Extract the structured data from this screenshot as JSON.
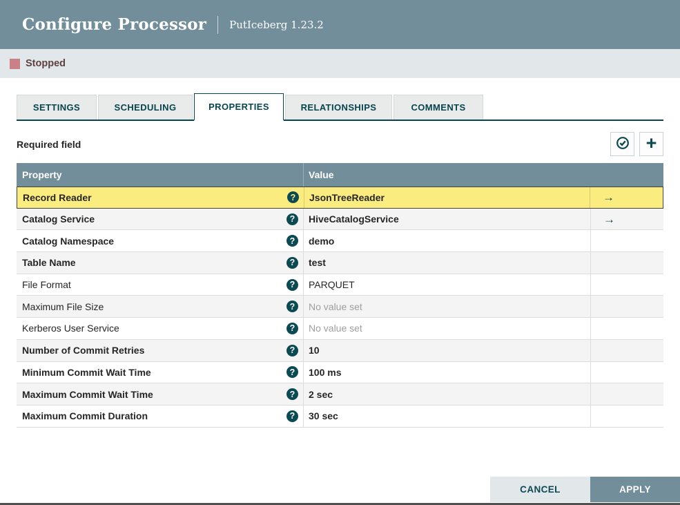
{
  "dialog": {
    "title": "Configure Processor",
    "subtitle": "PutIceberg 1.23.2"
  },
  "status": {
    "label": "Stopped",
    "color": "#CA8087"
  },
  "tabs": [
    {
      "label": "SETTINGS",
      "active": false
    },
    {
      "label": "SCHEDULING",
      "active": false
    },
    {
      "label": "PROPERTIES",
      "active": true
    },
    {
      "label": "RELATIONSHIPS",
      "active": false
    },
    {
      "label": "COMMENTS",
      "active": false
    }
  ],
  "properties_panel": {
    "required_field_label": "Required field",
    "table": {
      "columns": [
        "Property",
        "Value"
      ],
      "rows": [
        {
          "property": "Record Reader",
          "value": "JsonTreeReader",
          "required": true,
          "selected": true,
          "empty": false,
          "has_link": true
        },
        {
          "property": "Catalog Service",
          "value": "HiveCatalogService",
          "required": true,
          "selected": false,
          "empty": false,
          "has_link": true
        },
        {
          "property": "Catalog Namespace",
          "value": "demo",
          "required": true,
          "selected": false,
          "empty": false,
          "has_link": false
        },
        {
          "property": "Table Name",
          "value": "test",
          "required": true,
          "selected": false,
          "empty": false,
          "has_link": false
        },
        {
          "property": "File Format",
          "value": "PARQUET",
          "required": false,
          "selected": false,
          "empty": false,
          "has_link": false
        },
        {
          "property": "Maximum File Size",
          "value": "No value set",
          "required": false,
          "selected": false,
          "empty": true,
          "has_link": false
        },
        {
          "property": "Kerberos User Service",
          "value": "No value set",
          "required": false,
          "selected": false,
          "empty": true,
          "has_link": false
        },
        {
          "property": "Number of Commit Retries",
          "value": "10",
          "required": true,
          "selected": false,
          "empty": false,
          "has_link": false
        },
        {
          "property": "Minimum Commit Wait Time",
          "value": "100 ms",
          "required": true,
          "selected": false,
          "empty": false,
          "has_link": false
        },
        {
          "property": "Maximum Commit Wait Time",
          "value": "2 sec",
          "required": true,
          "selected": false,
          "empty": false,
          "has_link": false
        },
        {
          "property": "Maximum Commit Duration",
          "value": "30 sec",
          "required": true,
          "selected": false,
          "empty": false,
          "has_link": false
        }
      ]
    }
  },
  "icons": {
    "help_glyph": "?",
    "plus_glyph": "+",
    "arrow_glyph": "→",
    "verify": "check-circle"
  },
  "footer": {
    "cancel_label": "CANCEL",
    "apply_label": "APPLY"
  },
  "colors": {
    "header": "#728E9B",
    "teal": "#07454D",
    "selected_row": "#FBEC80",
    "alt_row": "#F4F4F4",
    "status_bar": "#E2E7E9",
    "stopped_square": "#CA8087"
  }
}
